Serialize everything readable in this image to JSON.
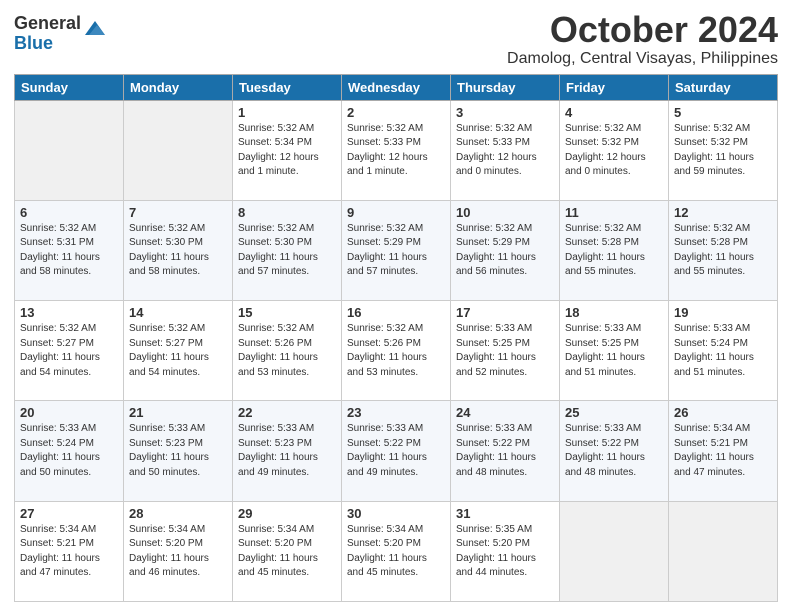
{
  "logo": {
    "general": "General",
    "blue": "Blue"
  },
  "header": {
    "month": "October 2024",
    "location": "Damolog, Central Visayas, Philippines"
  },
  "weekdays": [
    "Sunday",
    "Monday",
    "Tuesday",
    "Wednesday",
    "Thursday",
    "Friday",
    "Saturday"
  ],
  "weeks": [
    [
      {
        "day": "",
        "info": ""
      },
      {
        "day": "",
        "info": ""
      },
      {
        "day": "1",
        "info": "Sunrise: 5:32 AM\nSunset: 5:34 PM\nDaylight: 12 hours\nand 1 minute."
      },
      {
        "day": "2",
        "info": "Sunrise: 5:32 AM\nSunset: 5:33 PM\nDaylight: 12 hours\nand 1 minute."
      },
      {
        "day": "3",
        "info": "Sunrise: 5:32 AM\nSunset: 5:33 PM\nDaylight: 12 hours\nand 0 minutes."
      },
      {
        "day": "4",
        "info": "Sunrise: 5:32 AM\nSunset: 5:32 PM\nDaylight: 12 hours\nand 0 minutes."
      },
      {
        "day": "5",
        "info": "Sunrise: 5:32 AM\nSunset: 5:32 PM\nDaylight: 11 hours\nand 59 minutes."
      }
    ],
    [
      {
        "day": "6",
        "info": "Sunrise: 5:32 AM\nSunset: 5:31 PM\nDaylight: 11 hours\nand 58 minutes."
      },
      {
        "day": "7",
        "info": "Sunrise: 5:32 AM\nSunset: 5:30 PM\nDaylight: 11 hours\nand 58 minutes."
      },
      {
        "day": "8",
        "info": "Sunrise: 5:32 AM\nSunset: 5:30 PM\nDaylight: 11 hours\nand 57 minutes."
      },
      {
        "day": "9",
        "info": "Sunrise: 5:32 AM\nSunset: 5:29 PM\nDaylight: 11 hours\nand 57 minutes."
      },
      {
        "day": "10",
        "info": "Sunrise: 5:32 AM\nSunset: 5:29 PM\nDaylight: 11 hours\nand 56 minutes."
      },
      {
        "day": "11",
        "info": "Sunrise: 5:32 AM\nSunset: 5:28 PM\nDaylight: 11 hours\nand 55 minutes."
      },
      {
        "day": "12",
        "info": "Sunrise: 5:32 AM\nSunset: 5:28 PM\nDaylight: 11 hours\nand 55 minutes."
      }
    ],
    [
      {
        "day": "13",
        "info": "Sunrise: 5:32 AM\nSunset: 5:27 PM\nDaylight: 11 hours\nand 54 minutes."
      },
      {
        "day": "14",
        "info": "Sunrise: 5:32 AM\nSunset: 5:27 PM\nDaylight: 11 hours\nand 54 minutes."
      },
      {
        "day": "15",
        "info": "Sunrise: 5:32 AM\nSunset: 5:26 PM\nDaylight: 11 hours\nand 53 minutes."
      },
      {
        "day": "16",
        "info": "Sunrise: 5:32 AM\nSunset: 5:26 PM\nDaylight: 11 hours\nand 53 minutes."
      },
      {
        "day": "17",
        "info": "Sunrise: 5:33 AM\nSunset: 5:25 PM\nDaylight: 11 hours\nand 52 minutes."
      },
      {
        "day": "18",
        "info": "Sunrise: 5:33 AM\nSunset: 5:25 PM\nDaylight: 11 hours\nand 51 minutes."
      },
      {
        "day": "19",
        "info": "Sunrise: 5:33 AM\nSunset: 5:24 PM\nDaylight: 11 hours\nand 51 minutes."
      }
    ],
    [
      {
        "day": "20",
        "info": "Sunrise: 5:33 AM\nSunset: 5:24 PM\nDaylight: 11 hours\nand 50 minutes."
      },
      {
        "day": "21",
        "info": "Sunrise: 5:33 AM\nSunset: 5:23 PM\nDaylight: 11 hours\nand 50 minutes."
      },
      {
        "day": "22",
        "info": "Sunrise: 5:33 AM\nSunset: 5:23 PM\nDaylight: 11 hours\nand 49 minutes."
      },
      {
        "day": "23",
        "info": "Sunrise: 5:33 AM\nSunset: 5:22 PM\nDaylight: 11 hours\nand 49 minutes."
      },
      {
        "day": "24",
        "info": "Sunrise: 5:33 AM\nSunset: 5:22 PM\nDaylight: 11 hours\nand 48 minutes."
      },
      {
        "day": "25",
        "info": "Sunrise: 5:33 AM\nSunset: 5:22 PM\nDaylight: 11 hours\nand 48 minutes."
      },
      {
        "day": "26",
        "info": "Sunrise: 5:34 AM\nSunset: 5:21 PM\nDaylight: 11 hours\nand 47 minutes."
      }
    ],
    [
      {
        "day": "27",
        "info": "Sunrise: 5:34 AM\nSunset: 5:21 PM\nDaylight: 11 hours\nand 47 minutes."
      },
      {
        "day": "28",
        "info": "Sunrise: 5:34 AM\nSunset: 5:20 PM\nDaylight: 11 hours\nand 46 minutes."
      },
      {
        "day": "29",
        "info": "Sunrise: 5:34 AM\nSunset: 5:20 PM\nDaylight: 11 hours\nand 45 minutes."
      },
      {
        "day": "30",
        "info": "Sunrise: 5:34 AM\nSunset: 5:20 PM\nDaylight: 11 hours\nand 45 minutes."
      },
      {
        "day": "31",
        "info": "Sunrise: 5:35 AM\nSunset: 5:20 PM\nDaylight: 11 hours\nand 44 minutes."
      },
      {
        "day": "",
        "info": ""
      },
      {
        "day": "",
        "info": ""
      }
    ]
  ]
}
